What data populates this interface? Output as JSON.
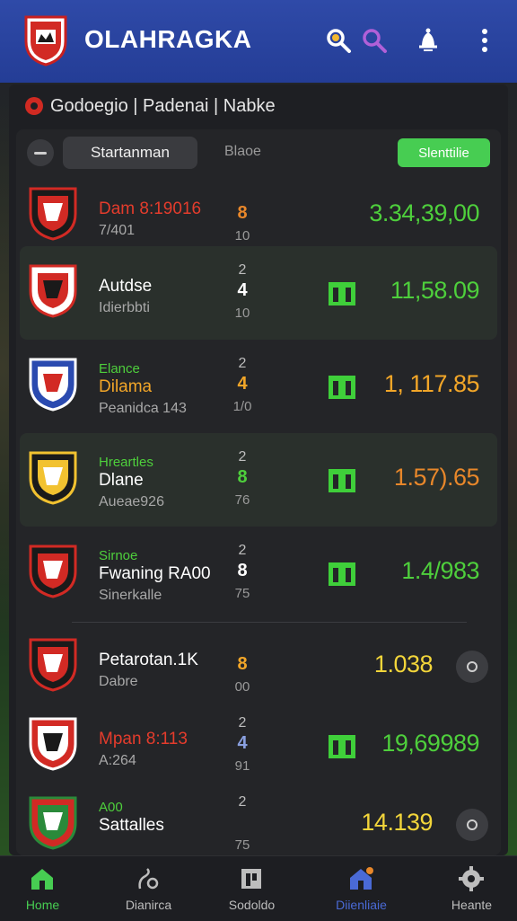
{
  "app": {
    "title": "OLAHRAGKA"
  },
  "breadcrumb": "Godoegio | Padenai | Nabke",
  "filters": {
    "active": "Startanman",
    "plain": "Blaoe",
    "action": "Slenttilie"
  },
  "colors": {
    "header": "#2f4aa8",
    "green": "#47cd52",
    "orange": "#e8872a",
    "red": "#e43c2c"
  },
  "matches": [
    {
      "top": "",
      "name": "Dam 8:19016",
      "sub": "7/401",
      "score_top": "",
      "score": "8",
      "score_bottom": "10",
      "odds": "3.34,39,00",
      "name_color": "#e43c2c",
      "score_color": "#e8872a",
      "odds_color": "#4ecf3c",
      "icon": "none"
    },
    {
      "top": "",
      "name": "Autdse",
      "sub": "Idierbbti",
      "score_top": "2",
      "score": "4",
      "score_bottom": "10",
      "odds": "11,58.09",
      "name_color": "#ffffff",
      "score_color": "#ffffff",
      "odds_color": "#4ecf3c",
      "icon": "calendar-icon"
    },
    {
      "top": "Elance",
      "name": "Dilama",
      "sub": "Peanidca 143",
      "score_top": "2",
      "score": "4",
      "score_bottom": "1/0",
      "odds": "1, 117.85",
      "name_color": "#f2a628",
      "score_color": "#f2a628",
      "odds_color": "#f2a628",
      "icon": "calendar-icon"
    },
    {
      "top": "Hreartles",
      "name": "Dlane",
      "sub": "Aueae926",
      "score_top": "2",
      "score": "8",
      "score_bottom": "76",
      "odds": "1.57).65",
      "name_color": "#ffffff",
      "score_color": "#4ecf3c",
      "odds_color": "#e8872a",
      "icon": "calendar-icon"
    },
    {
      "top": "Sirnoe",
      "name": "Fwaning RA00",
      "sub": "Sinerkalle",
      "score_top": "2",
      "score": "8",
      "score_bottom": "75",
      "odds": "1.4/983",
      "name_color": "#ffffff",
      "score_color": "#ffffff",
      "odds_color": "#4ecf3c",
      "icon": "calendar-icon"
    },
    {
      "top": "",
      "name": "Petarotan.1K",
      "sub": "Dabre",
      "score_top": "",
      "score": "8",
      "score_bottom": "00",
      "odds": "1.038",
      "name_color": "#ffffff",
      "score_color": "#f2a628",
      "odds_color": "#f2d53a",
      "icon": "circle-button"
    },
    {
      "top": "",
      "name": "Mpan 8:113",
      "sub": "A:264",
      "score_top": "2",
      "score": "4",
      "score_bottom": "91",
      "odds": "19,69989",
      "name_color": "#e43c2c",
      "score_color": "#8aa0e0",
      "odds_color": "#4ecf3c",
      "icon": "calendar-icon"
    },
    {
      "top": "A00",
      "name": "Sattalles",
      "sub": "",
      "score_top": "2",
      "score": "",
      "score_bottom": "75",
      "odds": "14.139",
      "name_color": "#ffffff",
      "score_color": "#ffffff",
      "odds_color": "#f2d53a",
      "icon": "circle-button"
    }
  ],
  "nav": [
    {
      "label": "Home",
      "icon": "home-icon",
      "color": "#47cd52"
    },
    {
      "label": "Dianirca",
      "icon": "stats-icon",
      "color": "#bdbdbd"
    },
    {
      "label": "Sodoldo",
      "icon": "card-icon",
      "color": "#bdbdbd"
    },
    {
      "label": "Diienliaie",
      "icon": "alerts-home-icon",
      "color": "#4a6ad6"
    },
    {
      "label": "Heante",
      "icon": "settings-icon",
      "color": "#bdbdbd"
    }
  ]
}
